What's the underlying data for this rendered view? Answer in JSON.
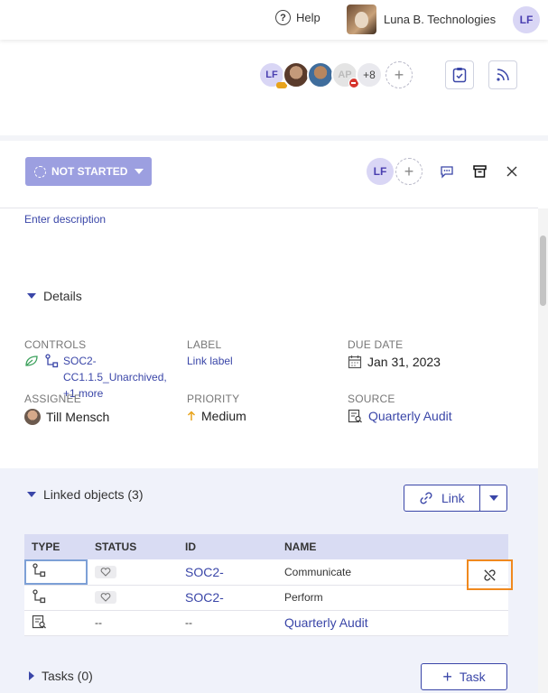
{
  "topbar": {
    "help_label": "Help",
    "org_name": "Luna B. Technologies",
    "user_initials": "LF"
  },
  "header": {
    "members": [
      "LF",
      "",
      "",
      "AP"
    ],
    "more_count": "+8"
  },
  "task": {
    "status_label": "NOT STARTED",
    "assignee_initials": "LF",
    "description_placeholder": "Enter description"
  },
  "details": {
    "title": "Details",
    "controls_label": "CONTROLS",
    "controls_value": "SOC2-",
    "controls_value2": "CC1.1.5_Unarchived,",
    "controls_more": "+1 more",
    "label_label": "LABEL",
    "label_value": "Link label",
    "due_label": "DUE DATE",
    "due_value": "Jan 31, 2023",
    "assignee_label": "ASSIGNEE",
    "assignee_value": "Till Mensch",
    "priority_label": "PRIORITY",
    "priority_value": "Medium",
    "source_label": "SOURCE",
    "source_value": "Quarterly Audit"
  },
  "linked": {
    "title": "Linked objects (3)",
    "link_button": "Link",
    "columns": [
      "TYPE",
      "STATUS",
      "ID",
      "NAME"
    ],
    "rows": [
      {
        "id": "SOC2-",
        "name": "Communicate"
      },
      {
        "id": "SOC2-",
        "name": "Perform"
      },
      {
        "status": "--",
        "id": "--",
        "name": "Quarterly Audit"
      }
    ]
  },
  "tasks": {
    "title": "Tasks (0)",
    "add_button": "Task"
  }
}
